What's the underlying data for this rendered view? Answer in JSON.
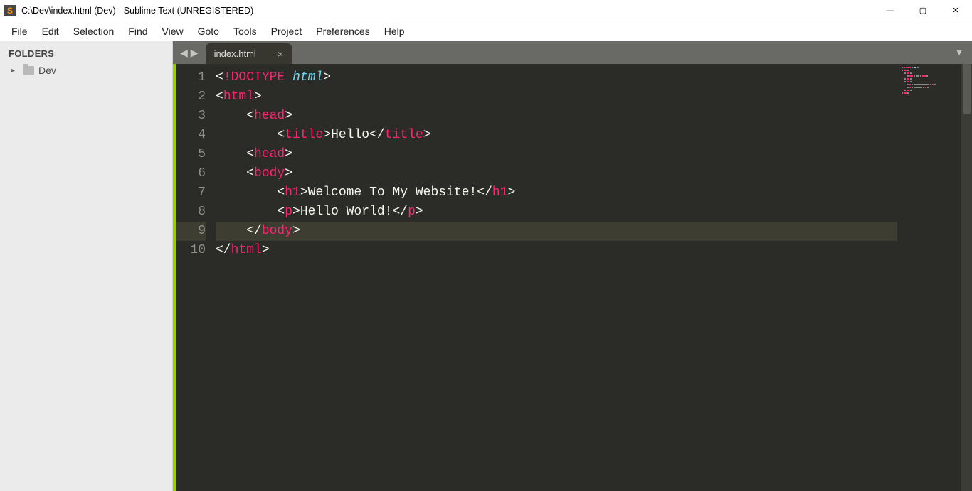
{
  "window": {
    "title": "C:\\Dev\\index.html (Dev) - Sublime Text (UNREGISTERED)",
    "minimize": "—",
    "maximize": "▢",
    "close": "✕"
  },
  "menu": {
    "items": [
      "File",
      "Edit",
      "Selection",
      "Find",
      "View",
      "Goto",
      "Tools",
      "Project",
      "Preferences",
      "Help"
    ]
  },
  "sidebar": {
    "heading": "FOLDERS",
    "folder": {
      "name": "Dev",
      "disclosure": "▸"
    }
  },
  "tabs": {
    "back": "◀",
    "forward": "▶",
    "active": {
      "label": "index.html",
      "close": "×"
    },
    "dropdown": "▼"
  },
  "gutter": {
    "numbers": [
      "1",
      "2",
      "3",
      "4",
      "5",
      "6",
      "7",
      "8",
      "9",
      "10"
    ]
  },
  "code": {
    "lines": [
      {
        "indent": "",
        "tokens": [
          {
            "t": "<",
            "c": "punct"
          },
          {
            "t": "!",
            "c": "doctype-kw"
          },
          {
            "t": "DOCTYPE",
            "c": "doctype-kw"
          },
          {
            "t": " ",
            "c": "punct"
          },
          {
            "t": "html",
            "c": "doctype-id"
          },
          {
            "t": ">",
            "c": "punct"
          }
        ]
      },
      {
        "indent": "",
        "tokens": [
          {
            "t": "<",
            "c": "punct"
          },
          {
            "t": "html",
            "c": "tagname"
          },
          {
            "t": ">",
            "c": "punct"
          }
        ]
      },
      {
        "indent": "    ",
        "tokens": [
          {
            "t": "<",
            "c": "punct"
          },
          {
            "t": "head",
            "c": "tagname"
          },
          {
            "t": ">",
            "c": "punct"
          }
        ]
      },
      {
        "indent": "        ",
        "tokens": [
          {
            "t": "<",
            "c": "punct"
          },
          {
            "t": "title",
            "c": "tagname"
          },
          {
            "t": ">",
            "c": "punct"
          },
          {
            "t": "Hello",
            "c": "text"
          },
          {
            "t": "</",
            "c": "punct"
          },
          {
            "t": "title",
            "c": "tagname"
          },
          {
            "t": ">",
            "c": "punct"
          }
        ]
      },
      {
        "indent": "    ",
        "tokens": [
          {
            "t": "<",
            "c": "punct"
          },
          {
            "t": "head",
            "c": "tagname"
          },
          {
            "t": ">",
            "c": "punct"
          }
        ]
      },
      {
        "indent": "    ",
        "tokens": [
          {
            "t": "<",
            "c": "punct"
          },
          {
            "t": "body",
            "c": "tagname"
          },
          {
            "t": ">",
            "c": "punct"
          }
        ]
      },
      {
        "indent": "        ",
        "tokens": [
          {
            "t": "<",
            "c": "punct"
          },
          {
            "t": "h1",
            "c": "tagname"
          },
          {
            "t": ">",
            "c": "punct"
          },
          {
            "t": "Welcome To My Website!",
            "c": "text"
          },
          {
            "t": "</",
            "c": "punct"
          },
          {
            "t": "h1",
            "c": "tagname"
          },
          {
            "t": ">",
            "c": "punct"
          }
        ]
      },
      {
        "indent": "        ",
        "tokens": [
          {
            "t": "<",
            "c": "punct"
          },
          {
            "t": "p",
            "c": "tagname"
          },
          {
            "t": ">",
            "c": "punct"
          },
          {
            "t": "Hello World!",
            "c": "text"
          },
          {
            "t": "</",
            "c": "punct"
          },
          {
            "t": "p",
            "c": "tagname"
          },
          {
            "t": ">",
            "c": "punct"
          }
        ]
      },
      {
        "indent": "    ",
        "tokens": [
          {
            "t": "</",
            "c": "punct"
          },
          {
            "t": "body",
            "c": "tagname"
          },
          {
            "t": ">",
            "c": "punct"
          }
        ],
        "current": true
      },
      {
        "indent": "",
        "tokens": [
          {
            "t": "</",
            "c": "punct"
          },
          {
            "t": "html",
            "c": "tagname"
          },
          {
            "t": ">",
            "c": "punct"
          }
        ]
      }
    ]
  },
  "appIcon": "S"
}
